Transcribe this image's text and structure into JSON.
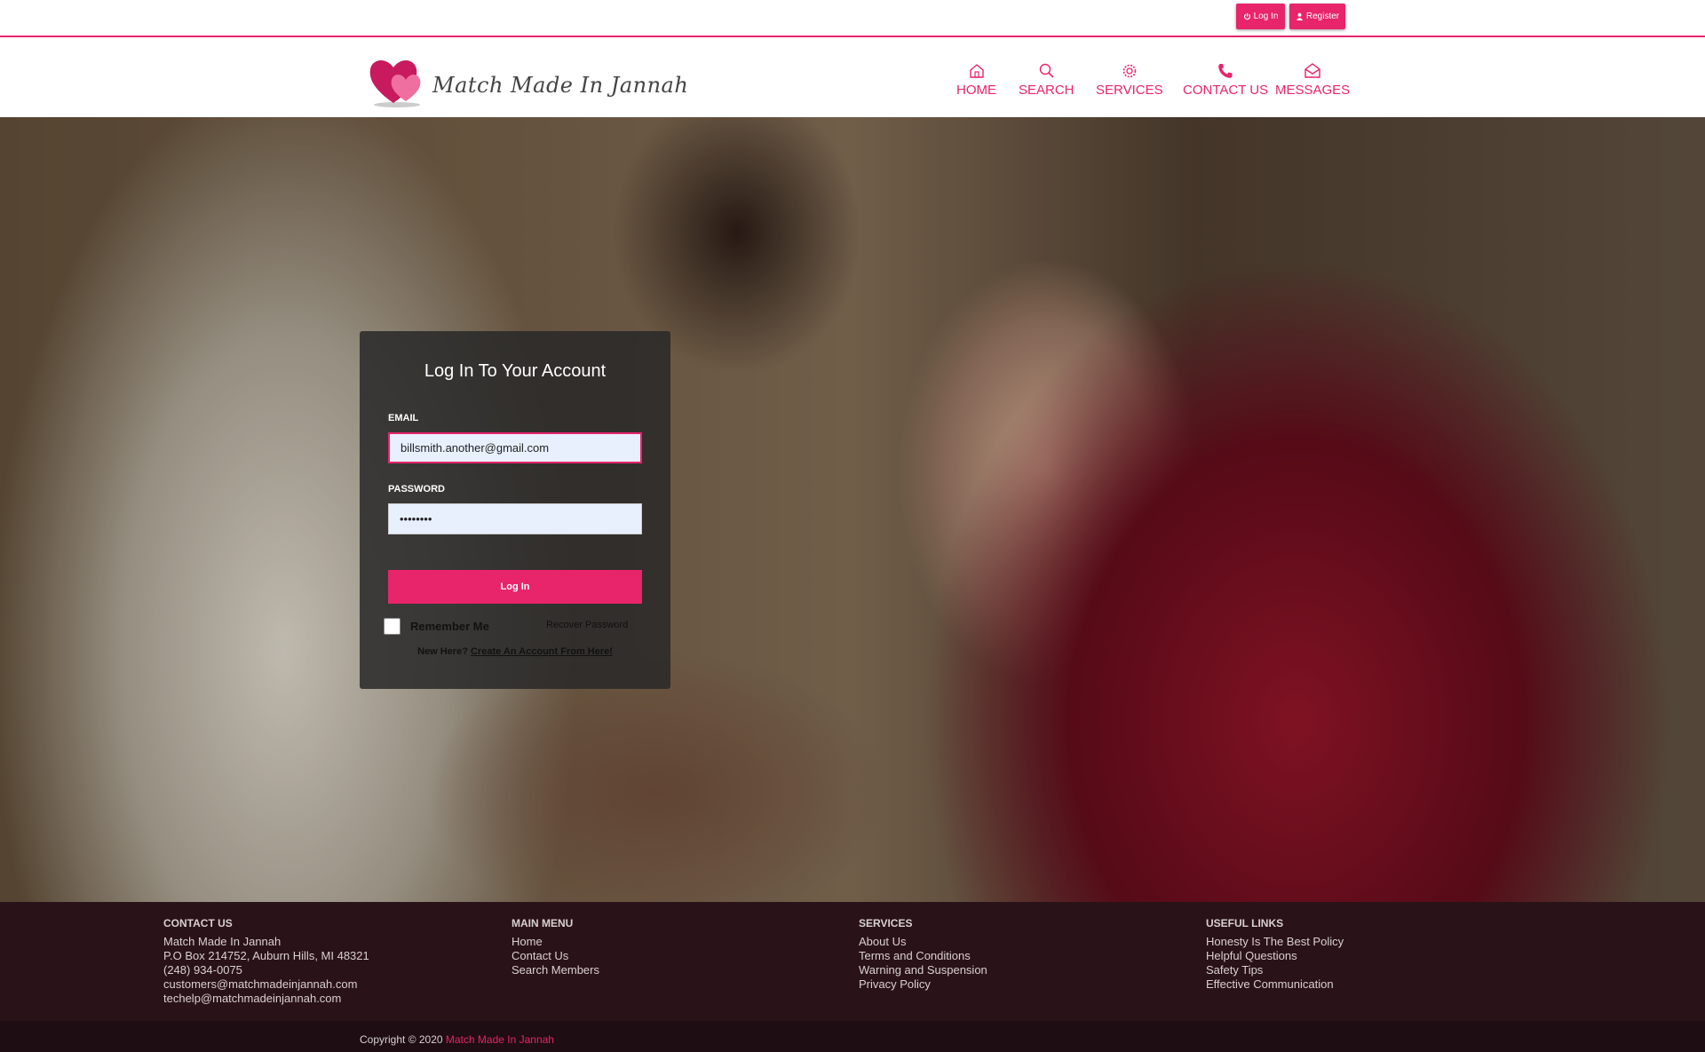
{
  "topbar": {
    "login_label": "Log In",
    "register_label": "Register"
  },
  "brand": {
    "name": "Match Made In Jannah",
    "accent_color": "#e8246a"
  },
  "nav": {
    "items": [
      {
        "label": "HOME",
        "icon": "home-icon"
      },
      {
        "label": "SEARCH",
        "icon": "search-icon"
      },
      {
        "label": "SERVICES",
        "icon": "gear-icon"
      },
      {
        "label": "CONTACT US",
        "icon": "phone-icon"
      },
      {
        "label": "MESSAGES",
        "icon": "envelope-icon"
      }
    ]
  },
  "login": {
    "title": "Log In To Your Account",
    "email_label": "EMAIL",
    "email_value": "billsmith.another@gmail.com",
    "password_label": "PASSWORD",
    "password_value": "••••••••",
    "submit_label": "Log In",
    "remember_label": "Remember Me",
    "recover_label": "Recover Password",
    "new_here": "New Here?",
    "create_account": "Create An Account From Here!"
  },
  "footer": {
    "contact": {
      "heading": "CONTACT US",
      "lines": [
        "Match Made In Jannah",
        "P.O Box 214752, Auburn Hills, MI 48321",
        "(248) 934-0075",
        "customers@matchmadeinjannah.com",
        "techelp@matchmadeinjannah.com"
      ]
    },
    "main_menu": {
      "heading": "MAIN MENU",
      "links": [
        "Home",
        "Contact Us",
        "Search Members"
      ]
    },
    "services": {
      "heading": "SERVICES",
      "links": [
        "About Us",
        "Terms and Conditions",
        "Warning and Suspension",
        "Privacy Policy"
      ]
    },
    "useful_links": {
      "heading": "USEFUL LINKS",
      "links": [
        "Honesty Is The Best Policy",
        "Helpful Questions",
        "Safety Tips",
        "Effective Communication"
      ]
    },
    "copyright_prefix": "Copyright © 2020",
    "copyright_brand": "Match Made In Jannah"
  }
}
